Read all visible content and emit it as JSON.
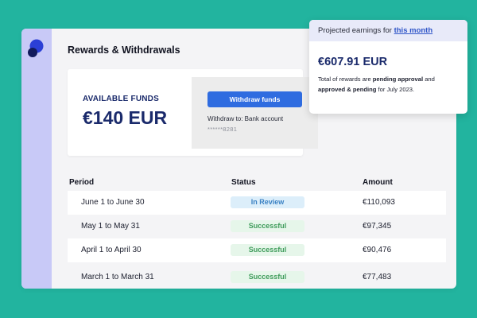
{
  "page_title": "Rewards & Withdrawals",
  "funds": {
    "label": "AVAILABLE FUNDS",
    "amount": "€140 EUR",
    "withdraw_button": "Withdraw funds",
    "withdraw_to": "Withdraw to: Bank account",
    "account_mask": "******8281"
  },
  "table": {
    "headers": {
      "period": "Period",
      "status": "Status",
      "amount": "Amount"
    },
    "rows": [
      {
        "period": "June 1 to June 30",
        "status": "In Review",
        "amount": "€110,093"
      },
      {
        "period": "May 1 to May 31",
        "status": "Successful",
        "amount": "€97,345"
      },
      {
        "period": "April 1 to April 30",
        "status": "Successful",
        "amount": "€90,476"
      },
      {
        "period": "March 1 to March 31",
        "status": "Successful",
        "amount": "€77,483"
      }
    ]
  },
  "projection": {
    "header_prefix": "Projected earnings for ",
    "header_link": "this month",
    "amount": "€607.91 EUR",
    "desc_1": "Total of rewards are ",
    "desc_bold_1": "pending approval",
    "desc_2": " and ",
    "desc_bold_2": "approved & pending",
    "desc_3": " for July 2023."
  },
  "colors": {
    "background": "#22b49f",
    "sidebar": "#c8c9f7",
    "primary": "#2f6ce0",
    "navy_text": "#1a2a6b",
    "status_review": "#3b82c4",
    "status_success": "#3f9c5b"
  },
  "icons": {
    "logo": "brand-logo-icon"
  }
}
